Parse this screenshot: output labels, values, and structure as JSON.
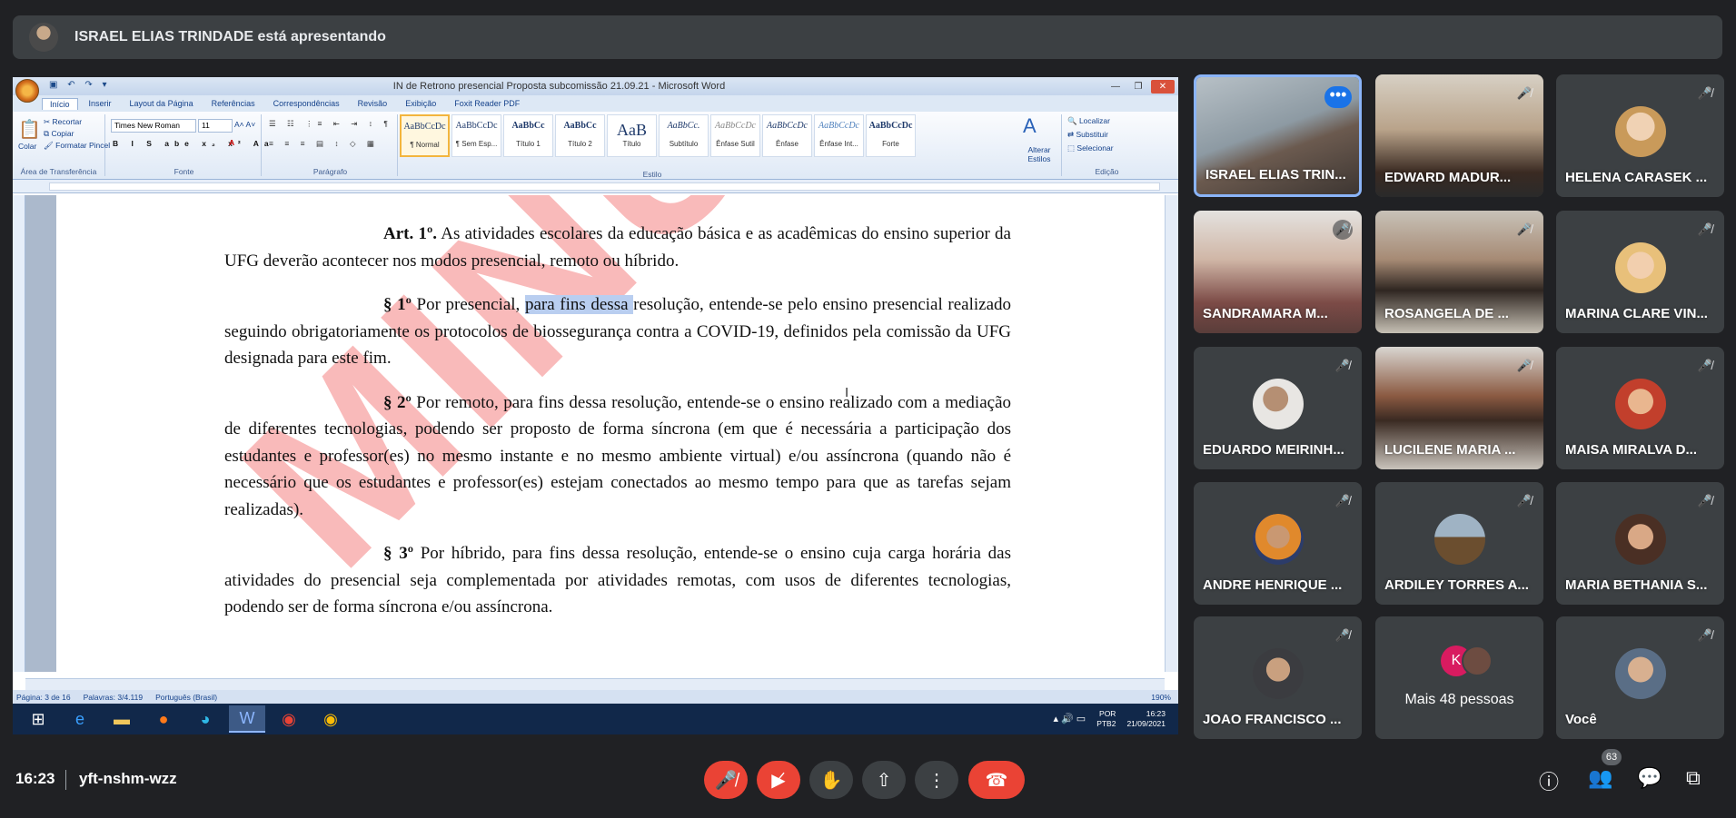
{
  "presenter_bar": {
    "text": "ISRAEL ELIAS TRINDADE está apresentando"
  },
  "word": {
    "title": "IN de Retrono presencial Proposta subcomissão 21.09.21 - Microsoft Word",
    "tabs": [
      "Início",
      "Inserir",
      "Layout da Página",
      "Referências",
      "Correspondências",
      "Revisão",
      "Exibição",
      "Foxit Reader PDF"
    ],
    "clipboard": {
      "paste": "Colar",
      "cut": "Recortar",
      "copy": "Copiar",
      "format": "Formatar Pincel",
      "label": "Área de Transferência"
    },
    "font": {
      "name": "Times New Roman",
      "size": "11",
      "label": "Fonte"
    },
    "paragraph_label": "Parágrafo",
    "styles_label": "Estilo",
    "styles": [
      {
        "preview": "AaBbCcDc",
        "name": "¶ Normal"
      },
      {
        "preview": "AaBbCcDc",
        "name": "¶ Sem Esp..."
      },
      {
        "preview": "AaBbCc",
        "name": "Título 1"
      },
      {
        "preview": "AaBbCc",
        "name": "Título 2"
      },
      {
        "preview": "AaB",
        "name": "Título"
      },
      {
        "preview": "AaBbCc.",
        "name": "Subtítulo"
      },
      {
        "preview": "AaBbCcDc",
        "name": "Ênfase Sutil"
      },
      {
        "preview": "AaBbCcDc",
        "name": "Ênfase"
      },
      {
        "preview": "AaBbCcDc",
        "name": "Ênfase Int..."
      },
      {
        "preview": "AaBbCcDc",
        "name": "Forte"
      }
    ],
    "change_styles": "Alterar Estilos",
    "editing": {
      "find": "Localizar",
      "replace": "Substituir",
      "select": "Selecionar",
      "label": "Edição"
    },
    "watermark": "MINUTA",
    "doc": {
      "p1_bold": "Art. 1º.",
      "p1_text": " As atividades escolares da educação básica e as acadêmicas do ensino superior da UFG deverão acontecer nos modos presencial, remoto ou híbrido.",
      "p2_bold": "§ 1º",
      "p2_a": " Por presencial, ",
      "p2_hl": "para fins dessa ",
      "p2_b": "resolução, entende-se pelo ensino presencial realizado seguindo obrigatoriamente os protocolos de biossegurança contra a COVID-19, definidos pela comissão da UFG designada para este fim.",
      "p3_bold": "§ 2º",
      "p3_text": " Por remoto, para fins dessa resolução, entende-se o ensino realizado com a mediação de diferentes tecnologias, podendo ser proposto de forma síncrona (em que é necessária a participação dos estudantes e professor(es) no mesmo instante e no mesmo ambiente virtual) e/ou assíncrona (quando não é necessário que os estudantes e professor(es) estejam conectados ao mesmo tempo para que as tarefas sejam realizadas).",
      "p4_bold": "§ 3º",
      "p4_text": " Por híbrido, para fins dessa resolução, entende-se o ensino cuja carga horária das atividades do presencial seja complementada por atividades remotas, com usos de diferentes tecnologias, podendo ser de forma síncrona e/ou assíncrona."
    },
    "status": {
      "page": "Página: 3 de 16",
      "words": "Palavras: 3/4.119",
      "lang": "Português (Brasil)",
      "zoom": "190%"
    },
    "taskbar": {
      "lang1": "POR",
      "lang2": "PTB2",
      "time": "16:23",
      "date": "21/09/2021"
    }
  },
  "participants": [
    {
      "name": "ISRAEL ELIAS TRIN...",
      "speaking": true
    },
    {
      "name": "EDWARD MADUR..."
    },
    {
      "name": "HELENA CARASEK ..."
    },
    {
      "name": "SANDRAMARA M..."
    },
    {
      "name": "ROSANGELA DE ..."
    },
    {
      "name": "MARINA CLARE VIN..."
    },
    {
      "name": "EDUARDO MEIRINH..."
    },
    {
      "name": "LUCILENE MARIA ..."
    },
    {
      "name": "MAISA MIRALVA D..."
    },
    {
      "name": "ANDRE HENRIQUE ..."
    },
    {
      "name": "ARDILEY TORRES A..."
    },
    {
      "name": "MARIA BETHANIA S..."
    },
    {
      "name": "JOAO FRANCISCO ..."
    },
    {
      "more": "Mais 48 pessoas",
      "initial": "K"
    },
    {
      "name": "Você"
    }
  ],
  "footer": {
    "time": "16:23",
    "code": "yft-nshm-wzz",
    "people_count": "63"
  },
  "icons": {
    "mic_off": "mic-off-icon",
    "cam_off": "camera-off-icon",
    "hand": "raise-hand-icon",
    "present": "present-screen-icon",
    "more": "more-options-icon",
    "end": "end-call-icon",
    "info": "info-icon",
    "people": "people-icon",
    "chat": "chat-icon",
    "activities": "activities-icon"
  }
}
